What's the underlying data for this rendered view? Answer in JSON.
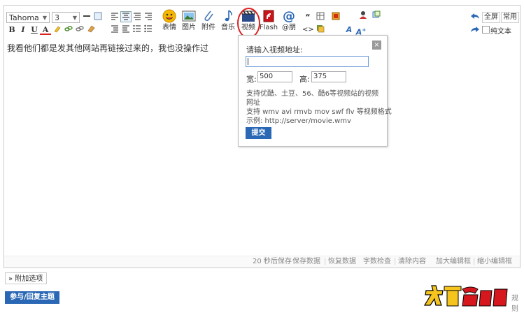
{
  "toolbar": {
    "font": "Tahoma",
    "size": "3",
    "format_buttons": [
      "B",
      "I",
      "U",
      "A"
    ],
    "big_buttons": [
      {
        "label": "表情",
        "icon": "smiley-icon"
      },
      {
        "label": "图片",
        "icon": "image-icon"
      },
      {
        "label": "附件",
        "icon": "paperclip-icon"
      },
      {
        "label": "音乐",
        "icon": "music-note-icon"
      },
      {
        "label": "视频",
        "icon": "video-clapper-icon"
      },
      {
        "label": "Flash",
        "icon": "flash-icon"
      },
      {
        "label": "@朋",
        "icon": "at-icon"
      }
    ],
    "right": {
      "fullscreen": "全屏",
      "common": "常用",
      "plain_text": "纯文本"
    }
  },
  "content": {
    "text": "我看他们都是发其他网站再链接过来的，我也没操作过"
  },
  "status_bar": {
    "autosave": "20 秒后保存",
    "save": "保存数据",
    "restore": "恢复数据",
    "count": "字数检查",
    "clear": "清除内容",
    "enlarge": "加大编辑框",
    "shrink": "缩小编辑框"
  },
  "popup": {
    "title": "请输入视频地址:",
    "url_value": "",
    "width_label": "宽:",
    "width_value": "500",
    "height_label": "高:",
    "height_value": "375",
    "note1": "支持优酷、土豆、56、酷6等视频站的视频",
    "note2": "网址",
    "note3": "支持 wmv avi rmvb mov swf flv 等视频格式",
    "note4": "示例: http://server/movie.wmv",
    "submit": "提交",
    "close": "×"
  },
  "footer": {
    "attach": "» 附加选项",
    "reply": "参与/回复主题",
    "logo_text": "大玩爱好者",
    "rule_text": "规则"
  },
  "colors": {
    "accent": "#2a67b5",
    "highlight": "#dd2222",
    "logo_red": "#d6181e",
    "logo_yellow": "#f6c51d"
  }
}
